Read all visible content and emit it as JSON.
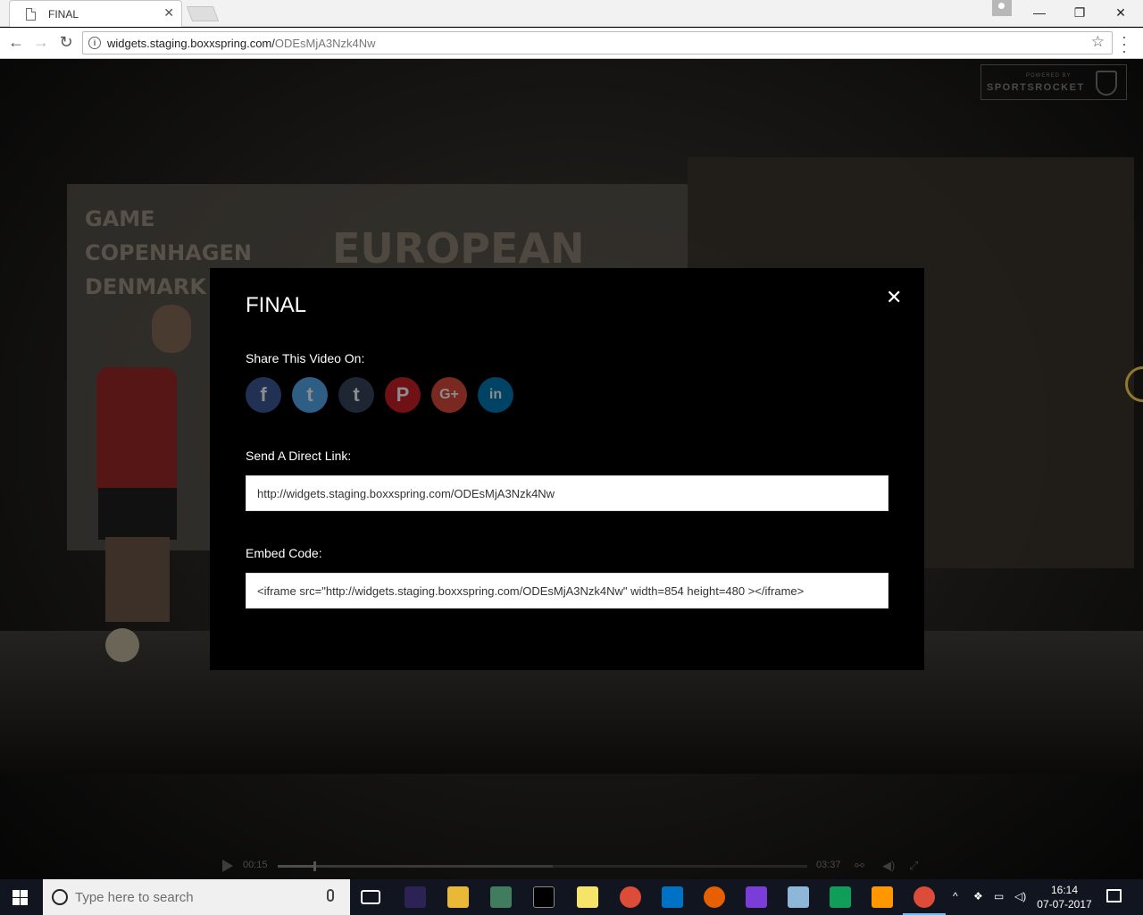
{
  "browser": {
    "tab_title": "FINAL",
    "tab_close": "✕",
    "url_domain": "widgets.staging.boxxspring.com/",
    "url_path": "ODEsMjA3Nzk4Nw",
    "window_controls": {
      "minimize": "—",
      "restore": "❐",
      "close": "✕"
    }
  },
  "logo": {
    "small": "POWERED BY",
    "big": "SPORTSROCKET"
  },
  "modal": {
    "title": "FINAL",
    "close": "✕",
    "share_label": "Share This Video On:",
    "share_icons": [
      {
        "name": "facebook-icon",
        "glyph": "f",
        "color": "#3b5998"
      },
      {
        "name": "twitter-icon",
        "glyph": "t",
        "color": "#55acee"
      },
      {
        "name": "tumblr-icon",
        "glyph": "t",
        "color": "#35465c"
      },
      {
        "name": "pinterest-icon",
        "glyph": "P",
        "color": "#cb2027"
      },
      {
        "name": "google-plus-icon",
        "glyph": "G+",
        "color": "#dd4b39"
      },
      {
        "name": "linkedin-icon",
        "glyph": "in",
        "color": "#007bb6"
      }
    ],
    "link_label": "Send A Direct Link:",
    "link_value": "http://widgets.staging.boxxspring.com/ODEsMjA3Nzk4Nw",
    "embed_label": "Embed Code:",
    "embed_value": "<iframe src=\"http://widgets.staging.boxxspring.com/ODEsMjA3Nzk4Nw\" width=854 height=480 ></iframe>"
  },
  "player": {
    "current_time": "00:15",
    "duration": "03:37",
    "progress_fraction": 0.068,
    "buffered_fraction": 0.52
  },
  "taskbar": {
    "search_placeholder": "Type here to search",
    "time": "16:14",
    "date": "07-07-2017",
    "apps": [
      {
        "name": "task-view-icon",
        "color": "transparent"
      },
      {
        "name": "eclipse-icon",
        "color": "#2c2255"
      },
      {
        "name": "file-explorer-icon",
        "color": "#e8b836"
      },
      {
        "name": "slack-icon",
        "color": "#3f7d5e"
      },
      {
        "name": "cmd-icon",
        "color": "#000000"
      },
      {
        "name": "sticky-notes-icon",
        "color": "#f6e36a"
      },
      {
        "name": "chrome-icon",
        "color": "#dd4b39"
      },
      {
        "name": "outlook-icon",
        "color": "#0072c6"
      },
      {
        "name": "firefox-icon",
        "color": "#e66000"
      },
      {
        "name": "git-icon",
        "color": "#7a3dd8"
      },
      {
        "name": "remote-desktop-icon",
        "color": "#8eb6d8"
      },
      {
        "name": "sheets-icon",
        "color": "#0f9d58"
      },
      {
        "name": "sublime-icon",
        "color": "#ff9800"
      },
      {
        "name": "chrome-active-icon",
        "color": "#dd4b39"
      }
    ]
  }
}
